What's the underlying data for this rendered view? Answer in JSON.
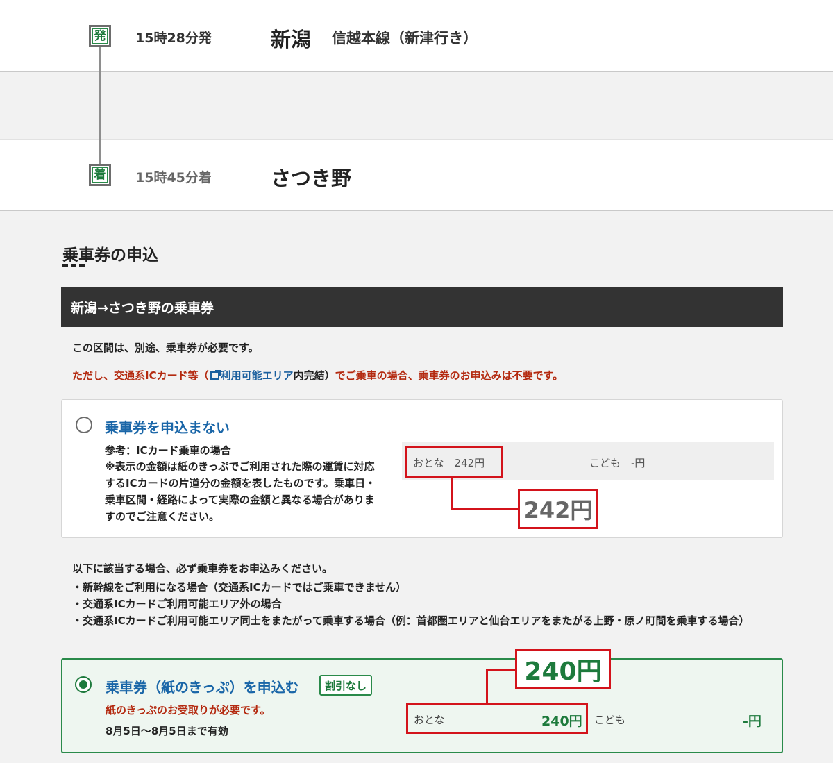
{
  "route": {
    "departure": {
      "badge": "発",
      "time": "15時28分発",
      "station": "新潟",
      "line": "信越本線（新津行き）"
    },
    "arrival": {
      "badge": "着",
      "time": "15時45分着",
      "station": "さつき野"
    }
  },
  "section": {
    "heading": "乗車券の申込"
  },
  "ticket": {
    "header": "新潟→さつき野の乗車券",
    "notice_required": "この区間は、別途、乗車券が必要です。",
    "notice_ic_prefix": "ただし、交通系ICカード等（",
    "notice_ic_link": "利用可能エリア",
    "notice_ic_mid": "内完結）",
    "notice_ic_suffix": "でご乗車の場合、乗車券のお申込みは不要です。"
  },
  "option_no_ticket": {
    "label": "乗車券を申込まない",
    "checked": false,
    "note_title": "参考：ICカード乗車の場合",
    "note_body": "※表示の金額は紙のきっぷでご利用された際の運賃に対応するICカードの片道分の金額を表したものです。乗車日・乗車区間・経路によって実際の金額と異なる場合がありますのでご注意ください。",
    "adult_fare": "おとな　242円",
    "child_fare": "こども　-円",
    "highlight_price": "242円"
  },
  "cases": {
    "title": "以下に該当する場合、必ず乗車券をお申込みください。",
    "items": [
      "・新幹線をご利用になる場合（交通系ICカードではご乗車できません）",
      "・交通系ICカードご利用可能エリア外の場合",
      "・交通系ICカードご利用可能エリア同士をまたがって乗車する場合（例：首都圏エリアと仙台エリアをまたがる上野・原ノ町間を乗車する場合）"
    ]
  },
  "option_paper_ticket": {
    "label": "乗車券（紙のきっぷ）を申込む",
    "checked": true,
    "badge": "割引なし",
    "pickup_note": "紙のきっぷのお受取りが必要です。",
    "validity": "8月5日〜8月5日まで有効",
    "adult_label": "おとな",
    "adult_fare": "240円",
    "child_label": "こども",
    "child_fare": "-円",
    "highlight_price": "240円"
  },
  "colors": {
    "accent_green": "#1d7a3c",
    "link_blue": "#1a66a8",
    "warning_red": "#b42a10",
    "highlight_red": "#d3131b",
    "header_dark": "#333333"
  }
}
